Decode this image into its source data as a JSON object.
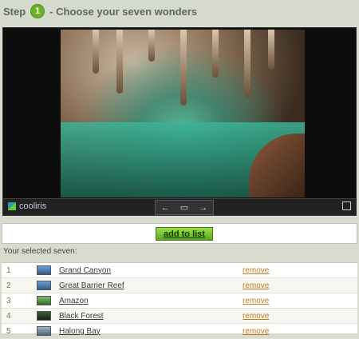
{
  "header": {
    "step_label": "Step",
    "step_number": "1",
    "title": "- Choose your seven wonders"
  },
  "viewer": {
    "brand": "cooliris",
    "prev_symbol": "←",
    "caption_symbol": "▭",
    "next_symbol": "→"
  },
  "actions": {
    "add_label": "add to list"
  },
  "selection": {
    "title": "Your selected seven:",
    "items": [
      {
        "num": "1",
        "name": "Grand Canyon",
        "remove": "remove"
      },
      {
        "num": "2",
        "name": "Great Barrier Reef",
        "remove": "remove"
      },
      {
        "num": "3",
        "name": "Amazon",
        "remove": "remove"
      },
      {
        "num": "4",
        "name": "Black Forest",
        "remove": "remove"
      },
      {
        "num": "5",
        "name": "Halong Bay",
        "remove": "remove"
      }
    ]
  },
  "colors": {
    "accent_green": "#6bb02a",
    "remove_orange": "#c07a1c"
  }
}
